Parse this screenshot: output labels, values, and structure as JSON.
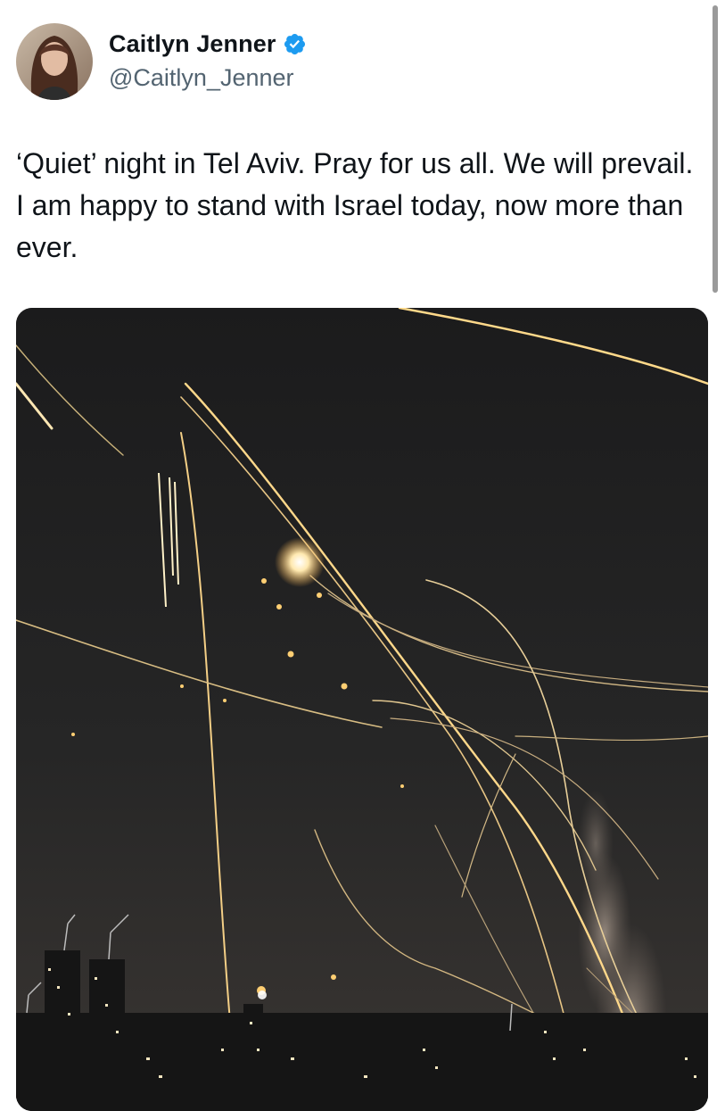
{
  "author": {
    "display_name": "Caitlyn Jenner",
    "handle": "@Caitlyn_Jenner",
    "verified": true,
    "verified_icon": "verified-badge-icon",
    "verified_color": "#1d9bf0"
  },
  "tweet": {
    "text": "‘Quiet’ night in Tel Aviv. Pray for us all. We will prevail. I am happy to stand with Israel today, now more than ever."
  },
  "media": {
    "kind": "photo"
  },
  "colors": {
    "text": "#0f1419",
    "secondary_text": "#536471",
    "background": "#ffffff",
    "scrollbar": "#9a9a9a"
  }
}
